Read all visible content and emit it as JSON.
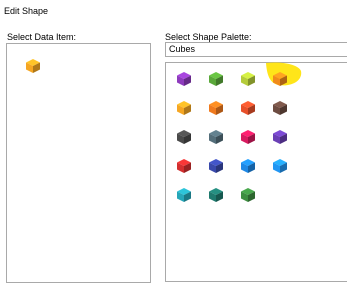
{
  "dialog": {
    "title": "Edit Shape"
  },
  "data_item": {
    "label": "Select Data Item:",
    "selected_color": "#f5a623"
  },
  "palette": {
    "label": "Select Shape Palette:",
    "selected": "Cubes",
    "cubes": [
      {
        "name": "purple",
        "color": "#8e3bbd"
      },
      {
        "name": "green",
        "color": "#5aa83a"
      },
      {
        "name": "yellow-green",
        "color": "#b5cc3a"
      },
      {
        "name": "orange-selected",
        "color": "#f08a1c"
      },
      {
        "name": "orange",
        "color": "#f5a623"
      },
      {
        "name": "dark-orange",
        "color": "#f07a1e"
      },
      {
        "name": "red-orange",
        "color": "#e8502a"
      },
      {
        "name": "brown",
        "color": "#6d4c41"
      },
      {
        "name": "dark-gray",
        "color": "#4a4a4a"
      },
      {
        "name": "slate",
        "color": "#546e7a"
      },
      {
        "name": "magenta",
        "color": "#d81b60"
      },
      {
        "name": "violet",
        "color": "#6a3fb5"
      },
      {
        "name": "red",
        "color": "#d32f2f"
      },
      {
        "name": "indigo",
        "color": "#3949ab"
      },
      {
        "name": "blue",
        "color": "#1e88e5"
      },
      {
        "name": "light-blue",
        "color": "#2196f3"
      },
      {
        "name": "cyan",
        "color": "#26a6b8"
      },
      {
        "name": "teal",
        "color": "#1f7a6e"
      },
      {
        "name": "forest-green",
        "color": "#3e8e41"
      }
    ]
  }
}
